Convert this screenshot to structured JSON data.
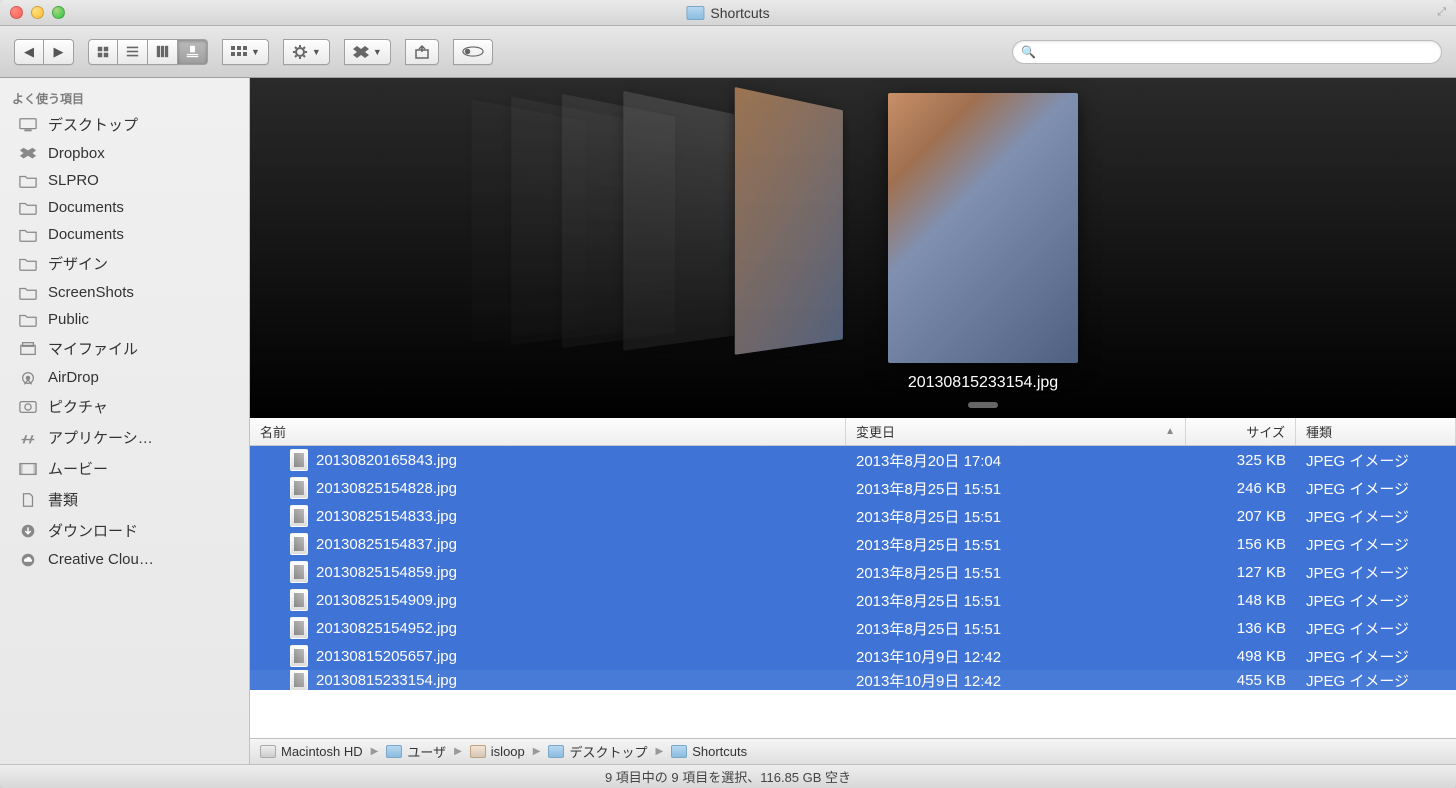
{
  "window_title": "Shortcuts",
  "sidebar": {
    "favorites_heading": "よく使う項目",
    "items": [
      {
        "label": "デスクトップ",
        "icon": "desktop-icon"
      },
      {
        "label": "Dropbox",
        "icon": "dropbox-icon"
      },
      {
        "label": "SLPRO",
        "icon": "folder-icon"
      },
      {
        "label": "Documents",
        "icon": "folder-icon"
      },
      {
        "label": "Documents",
        "icon": "folder-icon"
      },
      {
        "label": "デザイン",
        "icon": "folder-icon"
      },
      {
        "label": "ScreenShots",
        "icon": "folder-icon"
      },
      {
        "label": "Public",
        "icon": "folder-icon"
      },
      {
        "label": "マイファイル",
        "icon": "myfiles-icon"
      },
      {
        "label": "AirDrop",
        "icon": "airdrop-icon"
      },
      {
        "label": "ピクチャ",
        "icon": "pictures-icon"
      },
      {
        "label": "アプリケーシ…",
        "icon": "applications-icon"
      },
      {
        "label": "ムービー",
        "icon": "movies-icon"
      },
      {
        "label": "書類",
        "icon": "documents-icon"
      },
      {
        "label": "ダウンロード",
        "icon": "downloads-icon"
      },
      {
        "label": "Creative Clou…",
        "icon": "creativecloud-icon"
      }
    ]
  },
  "coverflow": {
    "selected_filename": "20130815233154.jpg"
  },
  "columns": {
    "name": "名前",
    "date": "変更日",
    "size": "サイズ",
    "kind": "種類"
  },
  "rows": [
    {
      "name": "20130820165843.jpg",
      "date": "2013年8月20日 17:04",
      "size": "325 KB",
      "kind": "JPEG イメージ"
    },
    {
      "name": "20130825154828.jpg",
      "date": "2013年8月25日 15:51",
      "size": "246 KB",
      "kind": "JPEG イメージ"
    },
    {
      "name": "20130825154833.jpg",
      "date": "2013年8月25日 15:51",
      "size": "207 KB",
      "kind": "JPEG イメージ"
    },
    {
      "name": "20130825154837.jpg",
      "date": "2013年8月25日 15:51",
      "size": "156 KB",
      "kind": "JPEG イメージ"
    },
    {
      "name": "20130825154859.jpg",
      "date": "2013年8月25日 15:51",
      "size": "127 KB",
      "kind": "JPEG イメージ"
    },
    {
      "name": "20130825154909.jpg",
      "date": "2013年8月25日 15:51",
      "size": "148 KB",
      "kind": "JPEG イメージ"
    },
    {
      "name": "20130825154952.jpg",
      "date": "2013年8月25日 15:51",
      "size": "136 KB",
      "kind": "JPEG イメージ"
    },
    {
      "name": "20130815205657.jpg",
      "date": "2013年10月9日 12:42",
      "size": "498 KB",
      "kind": "JPEG イメージ"
    },
    {
      "name": "20130815233154.jpg",
      "date": "2013年10月9日 12:42",
      "size": "455 KB",
      "kind": "JPEG イメージ"
    }
  ],
  "path": [
    {
      "label": "Macintosh HD",
      "icon": "disk"
    },
    {
      "label": "ユーザ",
      "icon": "folder"
    },
    {
      "label": "isloop",
      "icon": "home"
    },
    {
      "label": "デスクトップ",
      "icon": "folder"
    },
    {
      "label": "Shortcuts",
      "icon": "folder"
    }
  ],
  "status": "9 項目中の 9 項目を選択、116.85 GB 空き"
}
